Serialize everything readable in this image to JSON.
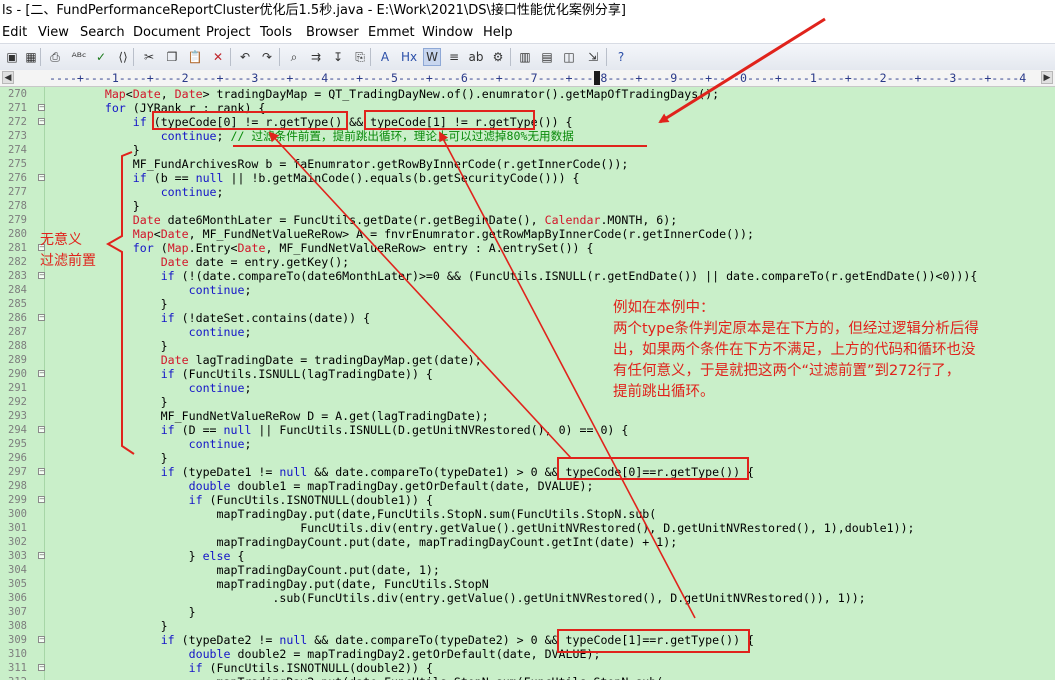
{
  "window": {
    "title": "ls - [二、FundPerformanceReportCluster优化后1.5秒.java - E:\\Work\\2021\\DS\\接口性能优化案例分享]"
  },
  "menu": [
    {
      "label": "Edit"
    },
    {
      "label": "View"
    },
    {
      "label": "Search"
    },
    {
      "label": "Document"
    },
    {
      "label": "Project"
    },
    {
      "label": "Tools"
    },
    {
      "label": "Browser"
    },
    {
      "label": "Emmet"
    },
    {
      "label": "Window"
    },
    {
      "label": "Help"
    }
  ],
  "toolbar": [
    {
      "name": "save-icon",
      "glyph": "▣"
    },
    {
      "name": "save-all-icon",
      "glyph": "▦"
    },
    {
      "name": "print-icon",
      "glyph": "⎙"
    },
    {
      "name": "spellcheck-icon",
      "glyph": "ᴬᴮᶜ"
    },
    {
      "name": "check-icon",
      "glyph": "✓"
    },
    {
      "name": "code-icon",
      "glyph": "⟨⟩"
    },
    {
      "name": "cut-icon",
      "glyph": "✂"
    },
    {
      "name": "copy-icon",
      "glyph": "❐"
    },
    {
      "name": "paste-icon",
      "glyph": "📋"
    },
    {
      "name": "delete-icon",
      "glyph": "✕"
    },
    {
      "name": "undo-icon",
      "glyph": "↶"
    },
    {
      "name": "redo-icon",
      "glyph": "↷"
    },
    {
      "name": "find-icon",
      "glyph": "⌕"
    },
    {
      "name": "find-next-icon",
      "glyph": "⇉"
    },
    {
      "name": "goto-icon",
      "glyph": "↧"
    },
    {
      "name": "bookmark-icon",
      "glyph": "⎘"
    },
    {
      "name": "font-size-icon",
      "glyph": "A"
    },
    {
      "name": "hex-icon",
      "glyph": "Hx"
    },
    {
      "name": "word-wrap-icon",
      "glyph": "W"
    },
    {
      "name": "indent-icon",
      "glyph": "≡"
    },
    {
      "name": "abc-icon",
      "glyph": "ab"
    },
    {
      "name": "settings-icon",
      "glyph": "⚙"
    },
    {
      "name": "column-icon",
      "glyph": "▥"
    },
    {
      "name": "window-icon",
      "glyph": "▤"
    },
    {
      "name": "browser-icon",
      "glyph": "◫"
    },
    {
      "name": "export-icon",
      "glyph": "⇲"
    },
    {
      "name": "help-icon",
      "glyph": "?"
    }
  ],
  "ruler": {
    "text": "----+----1----+----2----+----3----+----4----+----5----+----6----+----7----+----8----+----9----+----0----+----1----+----2----+----3----+----4"
  },
  "code": [
    {
      "n": "270",
      "fold": false,
      "segs": [
        [
          "",
          "        "
        ],
        [
          "ty",
          "Map"
        ],
        [
          "",
          "<"
        ],
        [
          "ty",
          "Date"
        ],
        [
          "",
          ", "
        ],
        [
          "ty",
          "Date"
        ],
        [
          "",
          "> tradingDayMap = QT_TradingDayNew.of().enumrator().getMapOfTradingDays();"
        ]
      ]
    },
    {
      "n": "271",
      "fold": true,
      "segs": [
        [
          "",
          "        "
        ],
        [
          "kw",
          "for"
        ],
        [
          "",
          " (JYRank r : rank) {"
        ]
      ]
    },
    {
      "n": "272",
      "fold": true,
      "segs": [
        [
          "",
          "            "
        ],
        [
          "kw",
          "if"
        ],
        [
          "",
          " (typeCode[0] != r.getType() && typeCode[1] != r.getType()) {"
        ]
      ]
    },
    {
      "n": "273",
      "fold": false,
      "segs": [
        [
          "",
          "                "
        ],
        [
          "kw",
          "continue"
        ],
        [
          "",
          "; "
        ],
        [
          "cm",
          "// 过滤条件前置，提前跳出循环，理论上可以过滤掉80%无用数据"
        ]
      ]
    },
    {
      "n": "274",
      "fold": false,
      "segs": [
        [
          "",
          "            }"
        ]
      ]
    },
    {
      "n": "275",
      "fold": false,
      "segs": [
        [
          "",
          "            MF_FundArchivesRow b = faEnumrator.getRowByInnerCode(r.getInnerCode());"
        ]
      ]
    },
    {
      "n": "276",
      "fold": true,
      "segs": [
        [
          "",
          "            "
        ],
        [
          "kw",
          "if"
        ],
        [
          "",
          " (b == "
        ],
        [
          "kw",
          "null"
        ],
        [
          "",
          " || !b.getMainCode().equals(b.getSecurityCode())) {"
        ]
      ]
    },
    {
      "n": "277",
      "fold": false,
      "segs": [
        [
          "",
          "                "
        ],
        [
          "kw",
          "continue"
        ],
        [
          "",
          ";"
        ]
      ]
    },
    {
      "n": "278",
      "fold": false,
      "segs": [
        [
          "",
          "            }"
        ]
      ]
    },
    {
      "n": "279",
      "fold": false,
      "segs": [
        [
          "",
          "            "
        ],
        [
          "ty",
          "Date"
        ],
        [
          "",
          " date6MonthLater = FuncUtils.getDate(r.getBeginDate(), "
        ],
        [
          "ty",
          "Calendar"
        ],
        [
          "",
          ".MONTH, 6);"
        ]
      ]
    },
    {
      "n": "280",
      "fold": false,
      "segs": [
        [
          "",
          "            "
        ],
        [
          "ty",
          "Map"
        ],
        [
          "",
          "<"
        ],
        [
          "ty",
          "Date"
        ],
        [
          "",
          ", MF_FundNetValueReRow> A = fnvrEnumrator.getRowMapByInnerCode(r.getInnerCode());"
        ]
      ]
    },
    {
      "n": "281",
      "fold": true,
      "segs": [
        [
          "",
          "            "
        ],
        [
          "kw",
          "for"
        ],
        [
          "",
          " ("
        ],
        [
          "ty",
          "Map"
        ],
        [
          "",
          ".Entry<"
        ],
        [
          "ty",
          "Date"
        ],
        [
          "",
          ", MF_FundNetValueReRow> entry : A.entrySet()) {"
        ]
      ]
    },
    {
      "n": "282",
      "fold": false,
      "segs": [
        [
          "",
          "                "
        ],
        [
          "ty",
          "Date"
        ],
        [
          "",
          " date = entry.getKey();"
        ]
      ]
    },
    {
      "n": "283",
      "fold": true,
      "segs": [
        [
          "",
          "                "
        ],
        [
          "kw",
          "if"
        ],
        [
          "",
          " (!(date.compareTo(date6MonthLater)>=0 && (FuncUtils.ISNULL(r.getEndDate()) || date.compareTo(r.getEndDate())<0))){"
        ]
      ]
    },
    {
      "n": "284",
      "fold": false,
      "segs": [
        [
          "",
          "                    "
        ],
        [
          "kw",
          "continue"
        ],
        [
          "",
          ";"
        ]
      ]
    },
    {
      "n": "285",
      "fold": false,
      "segs": [
        [
          "",
          "                }"
        ]
      ]
    },
    {
      "n": "286",
      "fold": true,
      "segs": [
        [
          "",
          "                "
        ],
        [
          "kw",
          "if"
        ],
        [
          "",
          " (!dateSet.contains(date)) {"
        ]
      ]
    },
    {
      "n": "287",
      "fold": false,
      "segs": [
        [
          "",
          "                    "
        ],
        [
          "kw",
          "continue"
        ],
        [
          "",
          ";"
        ]
      ]
    },
    {
      "n": "288",
      "fold": false,
      "segs": [
        [
          "",
          "                }"
        ]
      ]
    },
    {
      "n": "289",
      "fold": false,
      "segs": [
        [
          "",
          "                "
        ],
        [
          "ty",
          "Date"
        ],
        [
          "",
          " lagTradingDate = tradingDayMap.get(date);"
        ]
      ]
    },
    {
      "n": "290",
      "fold": true,
      "segs": [
        [
          "",
          "                "
        ],
        [
          "kw",
          "if"
        ],
        [
          "",
          " (FuncUtils.ISNULL(lagTradingDate)) {"
        ]
      ]
    },
    {
      "n": "291",
      "fold": false,
      "segs": [
        [
          "",
          "                    "
        ],
        [
          "kw",
          "continue"
        ],
        [
          "",
          ";"
        ]
      ]
    },
    {
      "n": "292",
      "fold": false,
      "segs": [
        [
          "",
          "                }"
        ]
      ]
    },
    {
      "n": "293",
      "fold": false,
      "segs": [
        [
          "",
          "                MF_FundNetValueReRow D = A.get(lagTradingDate);"
        ]
      ]
    },
    {
      "n": "294",
      "fold": true,
      "segs": [
        [
          "",
          "                "
        ],
        [
          "kw",
          "if"
        ],
        [
          "",
          " (D == "
        ],
        [
          "kw",
          "null"
        ],
        [
          "",
          " || FuncUtils.ISNULL(D.getUnitNVRestored(), 0) == 0) {"
        ]
      ]
    },
    {
      "n": "295",
      "fold": false,
      "segs": [
        [
          "",
          "                    "
        ],
        [
          "kw",
          "continue"
        ],
        [
          "",
          ";"
        ]
      ]
    },
    {
      "n": "296",
      "fold": false,
      "segs": [
        [
          "",
          "                }"
        ]
      ]
    },
    {
      "n": "297",
      "fold": true,
      "segs": [
        [
          "",
          "                "
        ],
        [
          "kw",
          "if"
        ],
        [
          "",
          " (typeDate1 != "
        ],
        [
          "kw",
          "null"
        ],
        [
          "",
          " && date.compareTo(typeDate1) > 0 && typeCode[0]==r.getType()) {"
        ]
      ]
    },
    {
      "n": "298",
      "fold": false,
      "segs": [
        [
          "",
          "                    "
        ],
        [
          "kw",
          "double"
        ],
        [
          "",
          " double1 = mapTradingDay.getOrDefault(date, DVALUE);"
        ]
      ]
    },
    {
      "n": "299",
      "fold": true,
      "segs": [
        [
          "",
          "                    "
        ],
        [
          "kw",
          "if"
        ],
        [
          "",
          " (FuncUtils.ISNOTNULL(double1)) {"
        ]
      ]
    },
    {
      "n": "300",
      "fold": false,
      "segs": [
        [
          "",
          "                        mapTradingDay.put(date,FuncUtils.StopN.sum(FuncUtils.StopN.sub("
        ]
      ]
    },
    {
      "n": "301",
      "fold": false,
      "segs": [
        [
          "",
          "                                    FuncUtils.div(entry.getValue().getUnitNVRestored(), D.getUnitNVRestored(), 1),double1));"
        ]
      ]
    },
    {
      "n": "302",
      "fold": false,
      "segs": [
        [
          "",
          "                        mapTradingDayCount.put(date, mapTradingDayCount.getInt(date) + 1);"
        ]
      ]
    },
    {
      "n": "303",
      "fold": true,
      "segs": [
        [
          "",
          "                    } "
        ],
        [
          "kw",
          "else"
        ],
        [
          "",
          " {"
        ]
      ]
    },
    {
      "n": "304",
      "fold": false,
      "segs": [
        [
          "",
          "                        mapTradingDayCount.put(date, 1);"
        ]
      ]
    },
    {
      "n": "305",
      "fold": false,
      "segs": [
        [
          "",
          "                        mapTradingDay.put(date, FuncUtils.StopN"
        ]
      ]
    },
    {
      "n": "306",
      "fold": false,
      "segs": [
        [
          "",
          "                                .sub(FuncUtils.div(entry.getValue().getUnitNVRestored(), D.getUnitNVRestored()), 1));"
        ]
      ]
    },
    {
      "n": "307",
      "fold": false,
      "segs": [
        [
          "",
          "                    }"
        ]
      ]
    },
    {
      "n": "308",
      "fold": false,
      "segs": [
        [
          "",
          "                }"
        ]
      ]
    },
    {
      "n": "309",
      "fold": true,
      "segs": [
        [
          "",
          "                "
        ],
        [
          "kw",
          "if"
        ],
        [
          "",
          " (typeDate2 != "
        ],
        [
          "kw",
          "null"
        ],
        [
          "",
          " && date.compareTo(typeDate2) > 0 && typeCode[1]==r.getType()) {"
        ]
      ]
    },
    {
      "n": "310",
      "fold": false,
      "segs": [
        [
          "",
          "                    "
        ],
        [
          "kw",
          "double"
        ],
        [
          "",
          " double2 = mapTradingDay2.getOrDefault(date, DVALUE);"
        ]
      ]
    },
    {
      "n": "311",
      "fold": true,
      "segs": [
        [
          "",
          "                    "
        ],
        [
          "kw",
          "if"
        ],
        [
          "",
          " (FuncUtils.ISNOTNULL(double2)) {"
        ]
      ]
    },
    {
      "n": "312",
      "fold": false,
      "segs": [
        [
          "",
          "                        mapTradingDay2.put(date,FuncUtils.StopN.sum(FuncUtils.StopN.sub("
        ]
      ]
    }
  ],
  "annotations": {
    "left_note": [
      "无意义",
      "过滤前置"
    ],
    "right_note": [
      "例如在本例中：",
      "两个type条件判定原本是在下方的，但经过逻辑分析后得",
      "出，如果两个条件在下方不满足，上方的代码和循环也没",
      "有任何意义，于是就把这两个“过滤前置”到272行了，",
      "提前跳出循环。"
    ]
  },
  "colors": {
    "editor_background": "#c9efc9",
    "keyword": "#1515c8",
    "type": "#d2162a",
    "comment": "#0a8a0a",
    "annotation": "#e0231c"
  }
}
